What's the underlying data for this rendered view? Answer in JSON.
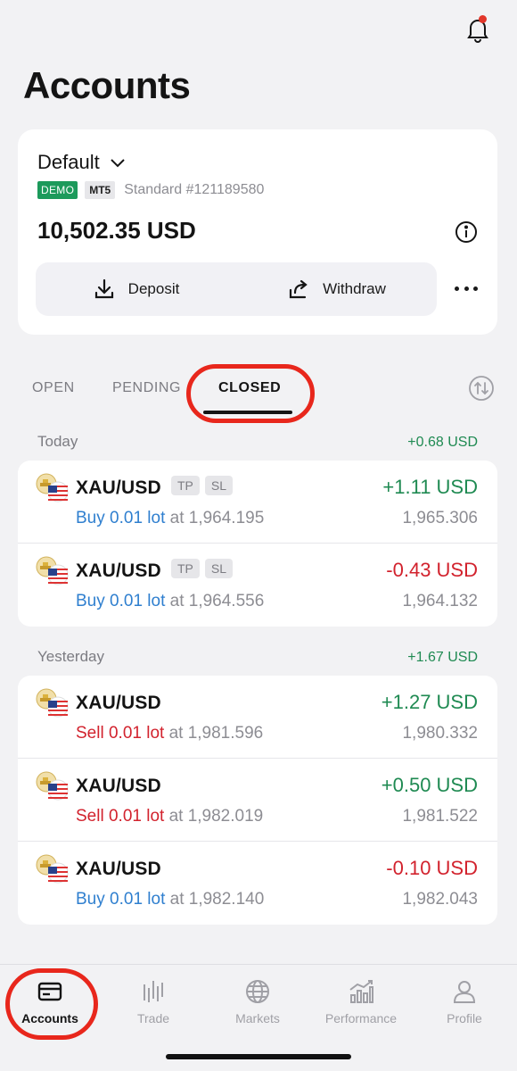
{
  "page_title": "Accounts",
  "account": {
    "name": "Default",
    "env_tag": "DEMO",
    "platform_tag": "MT5",
    "type_label": "Standard #121189580",
    "balance": "10,502.35 USD",
    "deposit_label": "Deposit",
    "withdraw_label": "Withdraw"
  },
  "tabs": [
    {
      "label": "OPEN"
    },
    {
      "label": "PENDING"
    },
    {
      "label": "CLOSED"
    }
  ],
  "active_tab": "CLOSED",
  "groups": [
    {
      "day": "Today",
      "total": "+0.68 USD",
      "trades": [
        {
          "symbol": "XAU/USD",
          "badges": [
            "TP",
            "SL"
          ],
          "side": "Buy",
          "volume": "0.01 lot",
          "at": "at 1,964.195",
          "pl": "+1.11 USD",
          "pl_sign": "pos",
          "close": "1,965.306"
        },
        {
          "symbol": "XAU/USD",
          "badges": [
            "TP",
            "SL"
          ],
          "side": "Buy",
          "volume": "0.01 lot",
          "at": "at 1,964.556",
          "pl": "-0.43 USD",
          "pl_sign": "neg",
          "close": "1,964.132"
        }
      ]
    },
    {
      "day": "Yesterday",
      "total": "+1.67 USD",
      "trades": [
        {
          "symbol": "XAU/USD",
          "badges": [],
          "side": "Sell",
          "volume": "0.01 lot",
          "at": "at 1,981.596",
          "pl": "+1.27 USD",
          "pl_sign": "pos",
          "close": "1,980.332"
        },
        {
          "symbol": "XAU/USD",
          "badges": [],
          "side": "Sell",
          "volume": "0.01 lot",
          "at": "at 1,982.019",
          "pl": "+0.50 USD",
          "pl_sign": "pos",
          "close": "1,981.522"
        },
        {
          "symbol": "XAU/USD",
          "badges": [],
          "side": "Buy",
          "volume": "0.01 lot",
          "at": "at 1,982.140",
          "pl": "-0.10 USD",
          "pl_sign": "neg",
          "close": "1,982.043"
        }
      ]
    }
  ],
  "bottom_nav": [
    {
      "label": "Accounts",
      "icon": "card-icon"
    },
    {
      "label": "Trade",
      "icon": "candles-icon"
    },
    {
      "label": "Markets",
      "icon": "globe-icon"
    },
    {
      "label": "Performance",
      "icon": "chart-icon"
    },
    {
      "label": "Profile",
      "icon": "person-icon"
    }
  ],
  "colors": {
    "positive": "#1f8a52",
    "negative": "#d2222d",
    "buy": "#2f7fcf",
    "demo_tag": "#1c9a5b",
    "highlight_circle": "#e8271c"
  }
}
